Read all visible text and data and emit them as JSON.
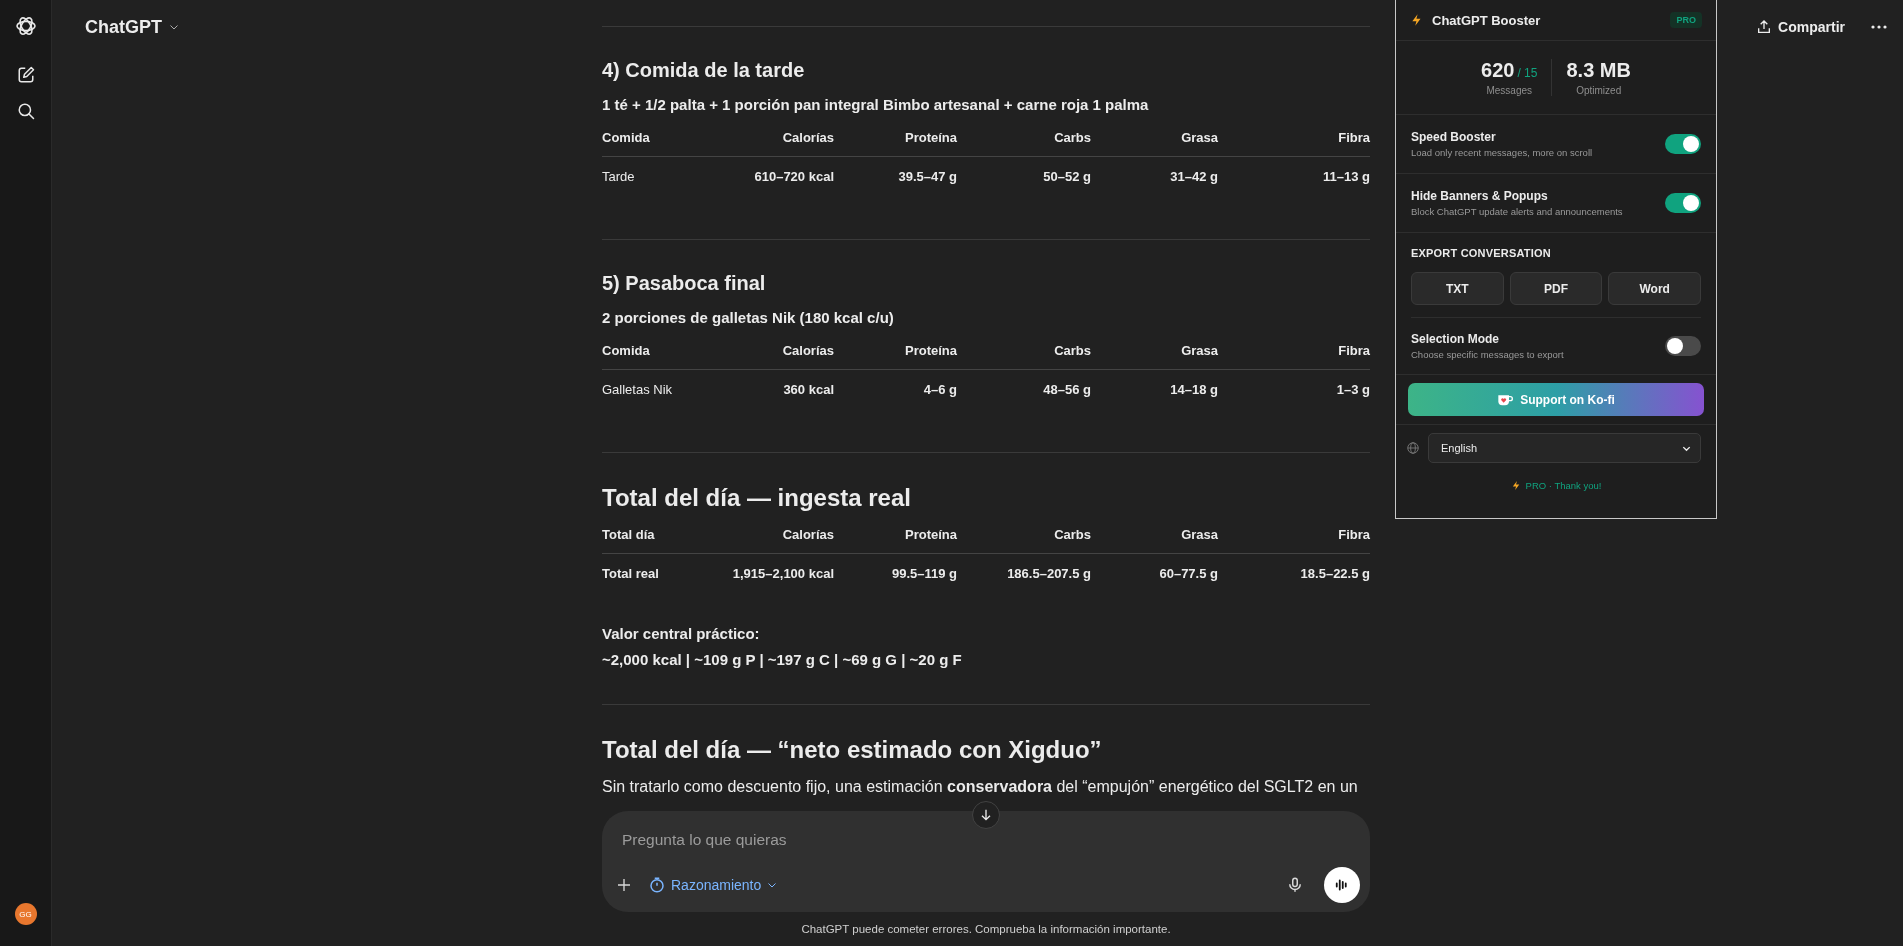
{
  "sidebar": {
    "avatar": "GG"
  },
  "header": {
    "title": "ChatGPT",
    "share_label": "Compartir"
  },
  "thread": {
    "blocks": [
      {
        "kind": "rule"
      },
      {
        "kind": "heading",
        "text": "4) Comida de la tarde"
      },
      {
        "kind": "subtitle",
        "text": "1 té + 1/2 palta + 1 porción pan integral Bimbo artesanal + carne roja 1 palma"
      },
      {
        "kind": "table",
        "columns": [
          "Comida",
          "Calorías",
          "Proteína",
          "Carbs",
          "Grasa",
          "Fibra"
        ],
        "rows": [
          {
            "strong": false,
            "cells": [
              "Tarde",
              "610–720 kcal",
              "39.5–47 g",
              "50–52 g",
              "31–42 g",
              "11–13 g"
            ]
          }
        ]
      },
      {
        "kind": "rule"
      },
      {
        "kind": "heading",
        "text": "5) Pasaboca final"
      },
      {
        "kind": "subtitle",
        "text": "2 porciones de galletas Nik (180 kcal c/u)"
      },
      {
        "kind": "table",
        "columns": [
          "Comida",
          "Calorías",
          "Proteína",
          "Carbs",
          "Grasa",
          "Fibra"
        ],
        "rows": [
          {
            "strong": false,
            "cells": [
              "Galletas Nik",
              "360 kcal",
              "4–6 g",
              "48–56 g",
              "14–18 g",
              "1–3 g"
            ]
          }
        ]
      },
      {
        "kind": "rule"
      },
      {
        "kind": "title",
        "text": "Total del día — ingesta real"
      },
      {
        "kind": "table",
        "columns": [
          "Total día",
          "Calorías",
          "Proteína",
          "Carbs",
          "Grasa",
          "Fibra"
        ],
        "rows": [
          {
            "strong": true,
            "cells": [
              "Total real",
              "1,915–2,100 kcal",
              "99.5–119 g",
              "186.5–207.5 g",
              "60–77.5 g",
              "18.5–22.5 g"
            ]
          }
        ]
      },
      {
        "kind": "note",
        "lines": [
          "Valor central práctico:",
          "~2,000 kcal | ~109 g P | ~197 g C | ~69 g G | ~20 g F"
        ]
      },
      {
        "kind": "rule"
      },
      {
        "kind": "title",
        "text": "Total del día — “neto estimado con Xigduo”"
      },
      {
        "kind": "paragraph",
        "text": "Sin tratarlo como descuento fijo, una estimación **conservadora** del “empujón” energético del SGLT2 en un"
      }
    ]
  },
  "composer": {
    "placeholder": "Pregunta lo que quieras",
    "mode": "Razonamiento",
    "disclaimer": "ChatGPT puede cometer errores. Comprueba la información importante."
  },
  "panel": {
    "title": "ChatGPT Booster",
    "badge": "PRO",
    "stats": [
      {
        "value": "620",
        "extra": "/ 15",
        "label": "Messages"
      },
      {
        "value": "8.3 MB",
        "label": "Optimized"
      }
    ],
    "toggles": [
      {
        "title": "Speed Booster",
        "description": "Load only recent messages, more on scroll",
        "on": true
      },
      {
        "title": "Hide Banners & Popups",
        "description": "Block ChatGPT update alerts and announcements",
        "on": true
      }
    ],
    "export": {
      "heading": "EXPORT CONVERSATION",
      "buttons": [
        "TXT",
        "PDF",
        "Word"
      ]
    },
    "selection_mode": {
      "title": "Selection Mode",
      "description": "Choose specific messages to export",
      "on": false
    },
    "support_button": "Support on Ko-fi",
    "language": "English",
    "footer": "PRO · Thank you!"
  }
}
